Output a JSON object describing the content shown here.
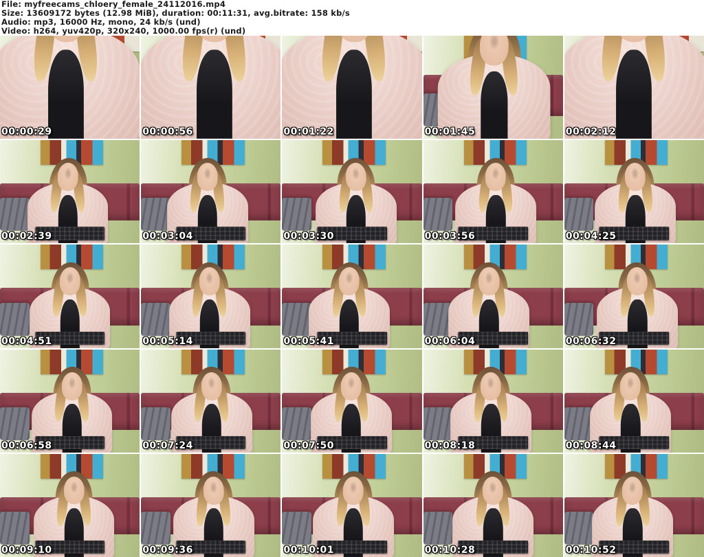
{
  "header": {
    "lines": [
      "File: myfreecams_chloery_female_24112016.mp4",
      "Size: 13609172 bytes (12.98 MiB), duration: 00:11:31, avg.bitrate: 158 kb/s",
      "Audio: mp3, 16000 Hz, mono, 24 kb/s (und)",
      "Video: h264, yuv420p, 320x240, 1000.00 fps(r) (und)"
    ]
  },
  "grid": {
    "columns": 5,
    "rows": 5
  },
  "colors": {
    "header_background": "#ffffff",
    "header_text": "#1a1a1a",
    "grid_gap": "#ffffff",
    "wall_green": "#c3cf9c",
    "headboard_maroon": "#8c3e4a",
    "fur_coat_pink": "#ecd2cb",
    "keyboard_black": "#232327",
    "timestamp_text": "#ffffff"
  },
  "thumbnails": [
    {
      "time": "00:00:29",
      "variant": "closeup"
    },
    {
      "time": "00:00:56",
      "variant": "closeup"
    },
    {
      "time": "00:01:22",
      "variant": "closeup"
    },
    {
      "time": "00:01:45",
      "variant": "medium"
    },
    {
      "time": "00:02:12",
      "variant": "closeup"
    },
    {
      "time": "00:02:39",
      "variant": "wide"
    },
    {
      "time": "00:03:04",
      "variant": "wide"
    },
    {
      "time": "00:03:30",
      "variant": "wide"
    },
    {
      "time": "00:03:56",
      "variant": "wide"
    },
    {
      "time": "00:04:25",
      "variant": "wide"
    },
    {
      "time": "00:04:51",
      "variant": "wide"
    },
    {
      "time": "00:05:14",
      "variant": "wide"
    },
    {
      "time": "00:05:41",
      "variant": "wide"
    },
    {
      "time": "00:06:04",
      "variant": "wide"
    },
    {
      "time": "00:06:32",
      "variant": "wide"
    },
    {
      "time": "00:06:58",
      "variant": "wide"
    },
    {
      "time": "00:07:24",
      "variant": "wide"
    },
    {
      "time": "00:07:50",
      "variant": "wide"
    },
    {
      "time": "00:08:18",
      "variant": "wide"
    },
    {
      "time": "00:08:44",
      "variant": "wide"
    },
    {
      "time": "00:09:10",
      "variant": "wide"
    },
    {
      "time": "00:09:36",
      "variant": "wide"
    },
    {
      "time": "00:10:01",
      "variant": "wide"
    },
    {
      "time": "00:10:28",
      "variant": "wide"
    },
    {
      "time": "00:10:52",
      "variant": "wide"
    }
  ]
}
